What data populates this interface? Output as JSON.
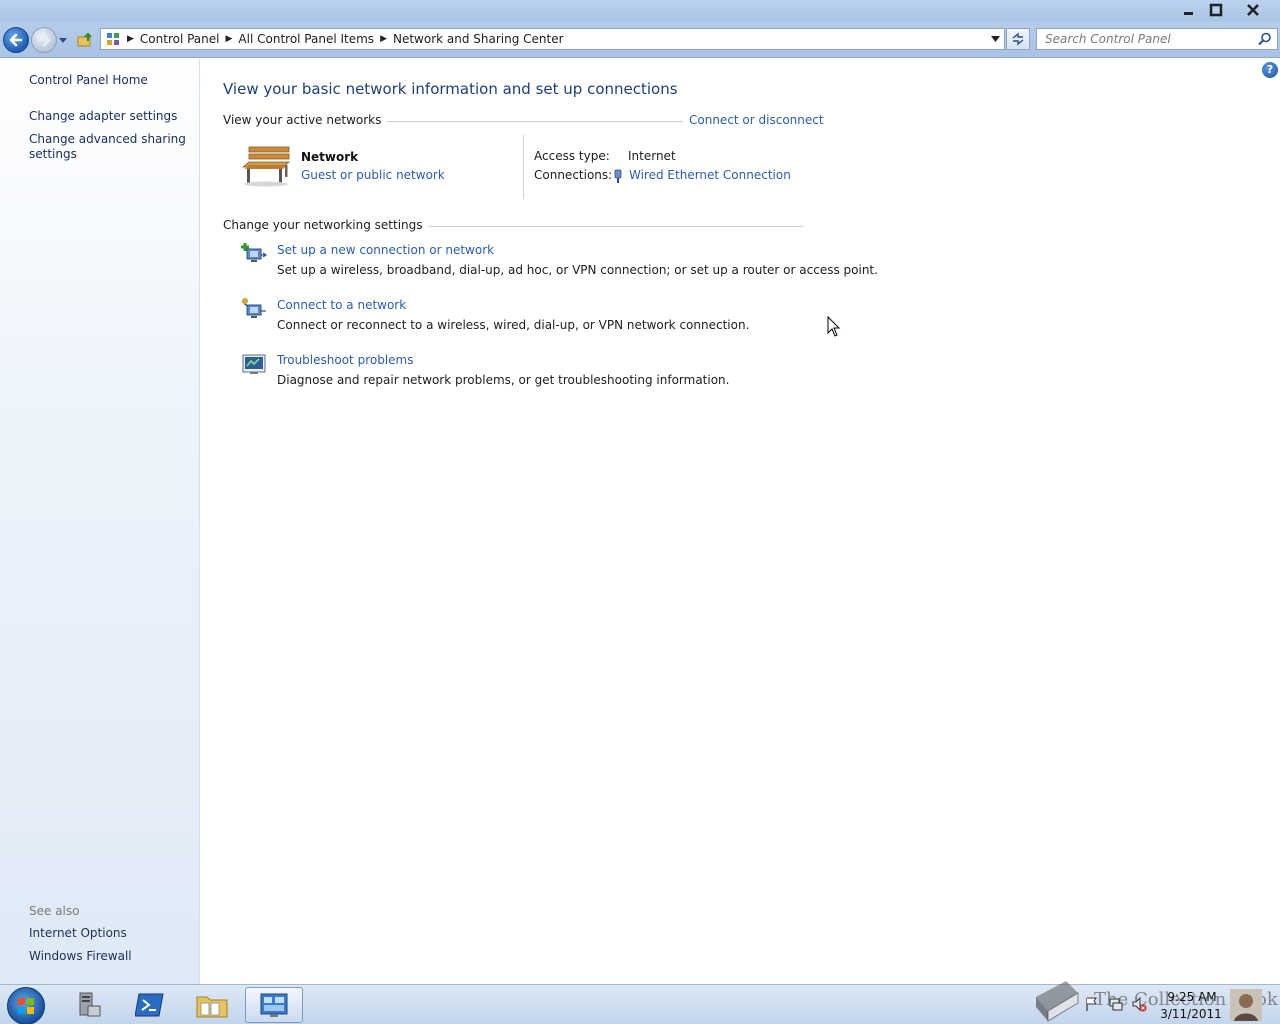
{
  "window": {
    "minimize_icon": "minimize-icon",
    "maximize_icon": "restore-icon",
    "close_icon": "close-icon"
  },
  "navbar": {
    "breadcrumbs": [
      "Control Panel",
      "All Control Panel Items",
      "Network and Sharing Center"
    ],
    "search_placeholder": "Search Control Panel"
  },
  "left_pane": {
    "home": "Control Panel Home",
    "links": [
      "Change adapter settings",
      "Change advanced sharing",
      "settings"
    ],
    "see_also_label": "See also",
    "see_also": [
      "Internet Options",
      "Windows Firewall"
    ]
  },
  "main": {
    "title": "View your basic network information and set up connections",
    "active_networks_label": "View your active networks",
    "connect_or_disconnect": "Connect or disconnect",
    "network": {
      "name": "Network",
      "type": "Guest or public network",
      "access_type_label": "Access type:",
      "access_type_value": "Internet",
      "connections_label": "Connections:",
      "connections_value": "Wired Ethernet Connection"
    },
    "change_settings_label": "Change your networking settings",
    "tasks": [
      {
        "link": "Set up a new connection or network",
        "desc": "Set up a wireless, broadband, dial-up, ad hoc, or VPN connection; or set up a router or access point."
      },
      {
        "link": "Connect to a network",
        "desc": "Connect or reconnect to a wireless, wired, dial-up, or VPN network connection."
      },
      {
        "link": "Troubleshoot problems",
        "desc": "Diagnose and repair network problems, or get troubleshooting information."
      }
    ],
    "help": "?"
  },
  "taskbar": {
    "time": "9:25 AM",
    "date": "3/11/2011",
    "watermark": "The Collection Book"
  },
  "colors": {
    "link": "#2a5db0",
    "title": "#1e3f7a",
    "left_pane_bg": "#dfe9f6",
    "chrome": "#a9c4e6"
  }
}
